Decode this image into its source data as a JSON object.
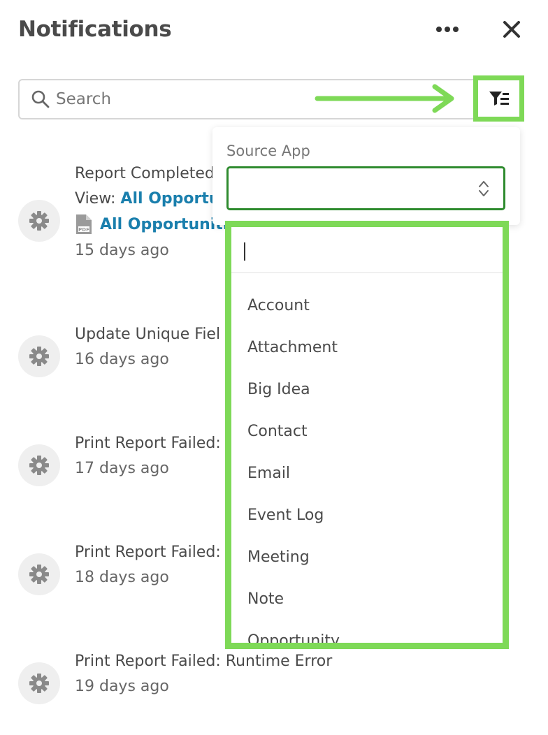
{
  "header": {
    "title": "Notifications"
  },
  "search": {
    "placeholder": "Search"
  },
  "notifications": [
    {
      "title": "Report Completed",
      "view_prefix": "View: ",
      "view_link": "All Opportu",
      "file_link": "All Opportunitie",
      "time": "15 days ago",
      "icon": "gear-icon"
    },
    {
      "title": "Update Unique Fiel",
      "time": "16 days ago",
      "icon": "gear-icon"
    },
    {
      "title": "Print Report Failed:",
      "time": "17 days ago",
      "icon": "gear-icon"
    },
    {
      "title": "Print Report Failed:",
      "time": "18 days ago",
      "icon": "gear-icon"
    },
    {
      "title": "Print Report Failed: Runtime Error",
      "time": "19 days ago",
      "icon": "gear-icon"
    }
  ],
  "filter": {
    "label": "Source App",
    "selected": "",
    "dropdown_search": "",
    "options": [
      "Account",
      "Attachment",
      "Big Idea",
      "Contact",
      "Email",
      "Event Log",
      "Meeting",
      "Note",
      "Opportunity"
    ]
  },
  "colors": {
    "highlight": "#7ed957",
    "link": "#1a7fad",
    "select_border": "#2e8b2e"
  }
}
